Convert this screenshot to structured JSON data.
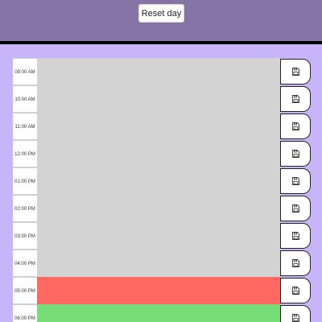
{
  "header": {
    "reset_label": "Reset day"
  },
  "colors": {
    "past": "#d3d3d3",
    "present": "#ff6961",
    "future": "#77dd77",
    "header": "#8674a6",
    "page": "#c8b4f8"
  },
  "hours": [
    {
      "time": "09:00 AM",
      "state": "past",
      "text": ""
    },
    {
      "time": "10:00 AM",
      "state": "past",
      "text": ""
    },
    {
      "time": "11:00 AM",
      "state": "past",
      "text": ""
    },
    {
      "time": "12:00 PM",
      "state": "past",
      "text": ""
    },
    {
      "time": "01:00 PM",
      "state": "past",
      "text": ""
    },
    {
      "time": "02:00 PM",
      "state": "past",
      "text": ""
    },
    {
      "time": "03:00 PM",
      "state": "past",
      "text": ""
    },
    {
      "time": "04:00 PM",
      "state": "past",
      "text": ""
    },
    {
      "time": "05:00 PM",
      "state": "present",
      "text": ""
    },
    {
      "time": "06:00 PM",
      "state": "future",
      "text": ""
    }
  ],
  "save_icon": "save-file-icon"
}
